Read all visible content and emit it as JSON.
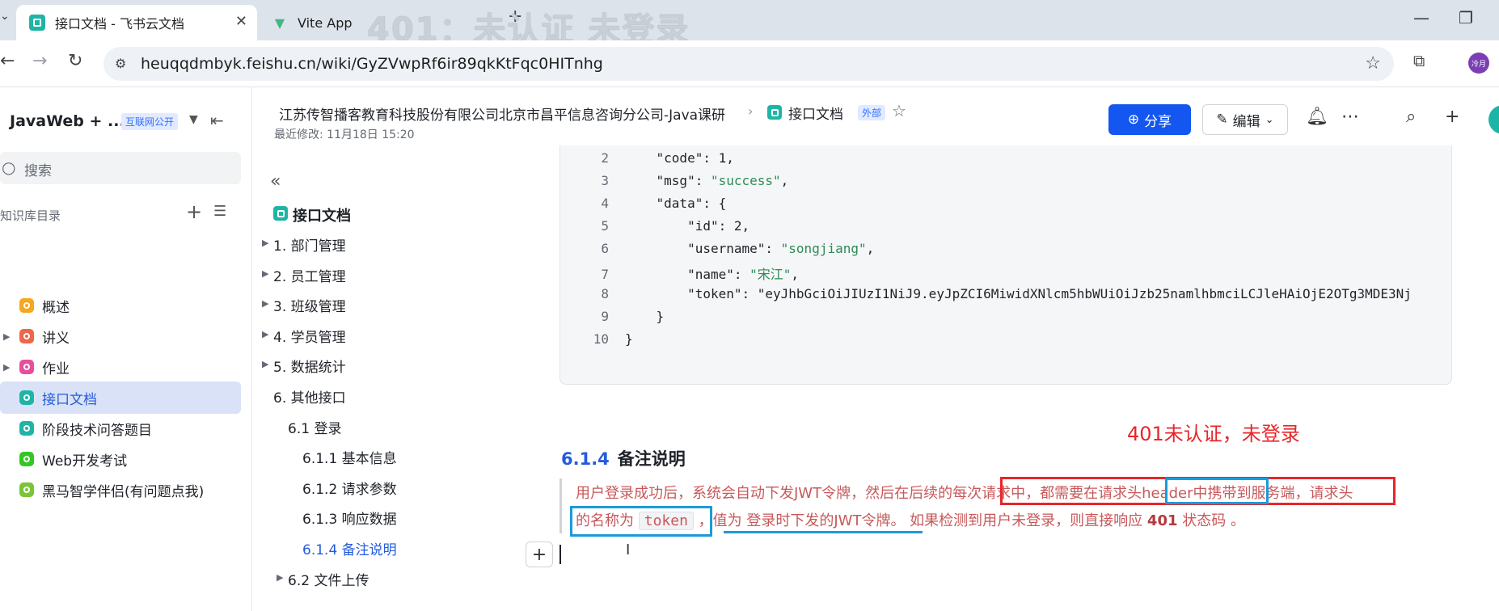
{
  "browser": {
    "tabs": [
      {
        "title": "接口文档 - 飞书云文档",
        "close": "✕"
      },
      {
        "title": "Vite App"
      }
    ],
    "overlay_title": "401：未认证 未登录",
    "url": "heuqqdmbyk.feishu.cn/wiki/GyZVwpRf6ir89qkKtFqc0HITnhg",
    "profile_initials": "冷月",
    "icons": {
      "back": "←",
      "forward": "→",
      "reload": "↻",
      "site": "⚙",
      "star": "☆",
      "extensions": "⧉",
      "minimize": "—",
      "restore": "❐",
      "new_tab": "+",
      "caret": "⌄"
    }
  },
  "sidebar": {
    "kb_title": "JavaWeb + ...",
    "kb_badge": "互联网公开",
    "search_placeholder": "搜索",
    "directory_label": "知识库目录",
    "items": [
      {
        "label": "概述",
        "color": "#f5a623",
        "has_children": false
      },
      {
        "label": "讲义",
        "color": "#f0654b",
        "has_children": true
      },
      {
        "label": "作业",
        "color": "#e84f9b",
        "has_children": true
      },
      {
        "label": "接口文档",
        "color": "#1fb5a6",
        "has_children": false,
        "selected": true
      },
      {
        "label": "阶段技术问答题目",
        "color": "#1fb5a6",
        "has_children": false
      },
      {
        "label": "Web开发考试",
        "color": "#34c724",
        "has_children": false
      },
      {
        "label": "黑马智学伴侣(有问题点我)",
        "color": "#7cc438",
        "has_children": false
      }
    ]
  },
  "header": {
    "breadcrumb_org": "江苏传智播客教育科技股份有限公司北京市昌平信息咨询分公司-Java课研",
    "breadcrumb_sep": "›",
    "breadcrumb_doc": "接口文档",
    "external_badge": "外部",
    "last_modified": "最近修改: 11月18日 15:20",
    "share_label": "分享",
    "edit_label": "编辑",
    "accent": "#1456f0"
  },
  "outline": {
    "title": "接口文档",
    "items": [
      {
        "label": "1. 部门管理",
        "caret": true,
        "level": 1
      },
      {
        "label": "2. 员工管理",
        "caret": true,
        "level": 1
      },
      {
        "label": "3. 班级管理",
        "caret": true,
        "level": 1
      },
      {
        "label": "4. 学员管理",
        "caret": true,
        "level": 1
      },
      {
        "label": "5. 数据统计",
        "caret": true,
        "level": 1
      },
      {
        "label": "6. 其他接口",
        "caret": false,
        "level": 1
      },
      {
        "label": "6.1 登录",
        "caret": false,
        "level": 2
      },
      {
        "label": "6.1.1 基本信息",
        "caret": false,
        "level": 3
      },
      {
        "label": "6.1.2 请求参数",
        "caret": false,
        "level": 3
      },
      {
        "label": "6.1.3 响应数据",
        "caret": false,
        "level": 3
      },
      {
        "label": "6.1.4 备注说明",
        "caret": false,
        "level": 3,
        "current": true
      },
      {
        "label": "6.2 文件上传",
        "caret": true,
        "level": 2
      }
    ]
  },
  "code": {
    "lines": [
      {
        "n": "2",
        "text": "    \"code\": 1,"
      },
      {
        "n": "3",
        "text": "    \"msg\": \"success\","
      },
      {
        "n": "4",
        "text": "    \"data\": {"
      },
      {
        "n": "5",
        "text": "        \"id\": 2,"
      },
      {
        "n": "6",
        "text": "        \"username\": \"songjiang\","
      },
      {
        "n": "7",
        "text": "        \"name\": \"宋江\","
      },
      {
        "n": "8",
        "text": "        \"token\": \"eyJhbGciOiJIUzI1NiJ9.eyJpZCI6MiwidXNlcm5hbWUiOiJzb25namlhbmciLCJleHAiOjE2OTg3MDE3Nj"
      },
      {
        "n": "9",
        "text": "    }"
      },
      {
        "n": "10",
        "text": "}"
      }
    ]
  },
  "section": {
    "annotation": "401未认证，未登录",
    "heading_num": "6.1.4",
    "heading_text": "备注说明",
    "line1_a": "用户登录成功后，系统会自动下发JWT令牌，然后在后续的每次请求中，都需要在请求头header中携带到服务端，请求头",
    "line2_a": "的名称为 ",
    "line2_code": "token",
    "line2_b": " ，值为 登录时下发的JWT令牌。 如果检测到用户未登录，则直接响应 ",
    "line2_bold": "401",
    "line2_c": " 状态码 。"
  }
}
